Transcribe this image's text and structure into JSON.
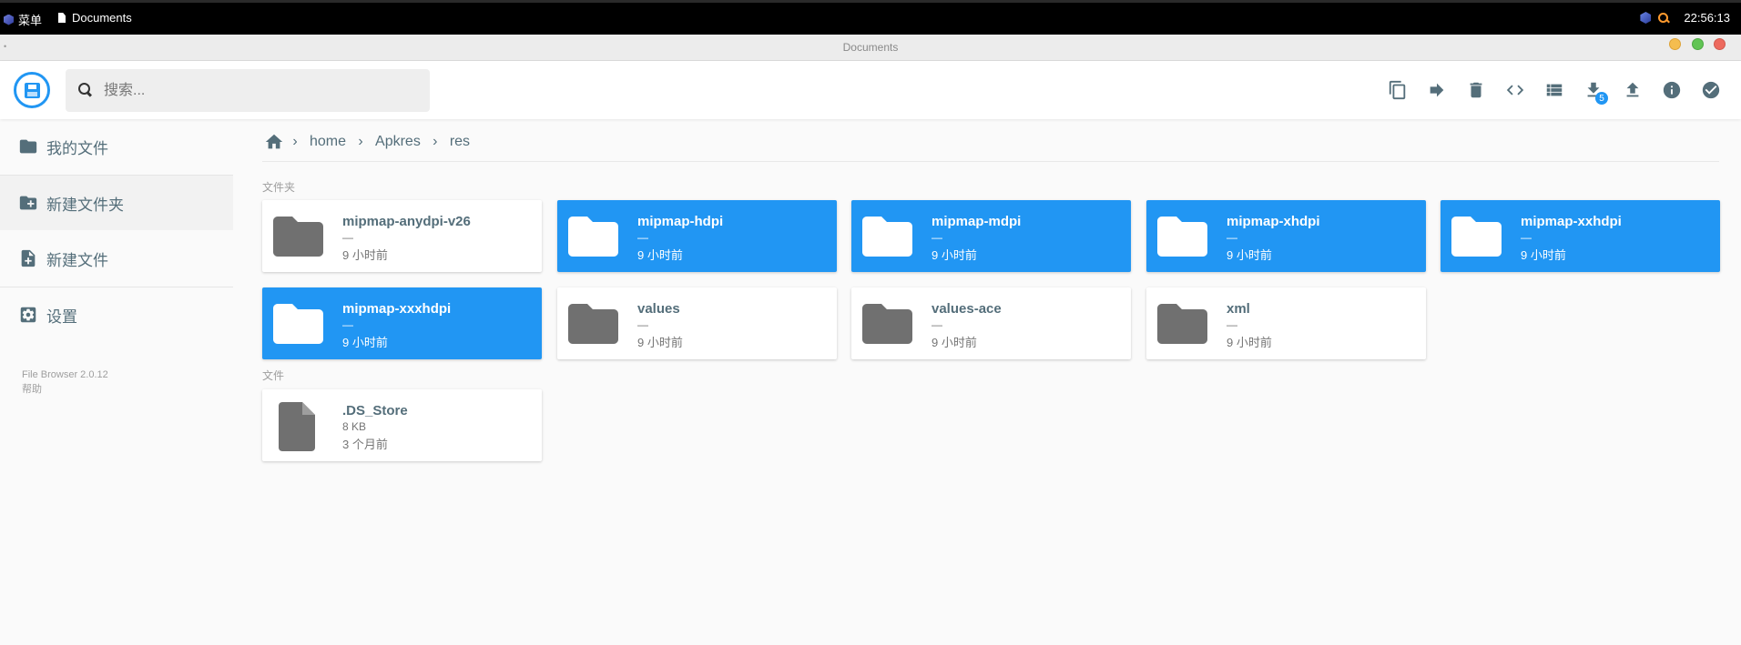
{
  "taskbar": {
    "menu_label": "菜单",
    "task_title": "Documents",
    "clock": "22:56:13"
  },
  "window": {
    "title": "Documents"
  },
  "search": {
    "placeholder": "搜索..."
  },
  "toolbar": {
    "actions": [
      "copy",
      "move",
      "delete",
      "embed",
      "view-mode",
      "download",
      "upload",
      "info",
      "select"
    ],
    "download_badge": "5"
  },
  "sidebar": {
    "items": [
      {
        "label": "我的文件",
        "icon": "folder-icon"
      },
      {
        "label": "新建文件夹",
        "icon": "create-new-folder-icon"
      },
      {
        "label": "新建文件",
        "icon": "note-add-icon"
      },
      {
        "label": "设置",
        "icon": "settings-icon"
      }
    ],
    "footer_version": "File Browser 2.0.12",
    "footer_help": "帮助"
  },
  "breadcrumbs": [
    "home",
    "Apkres",
    "res"
  ],
  "sections": {
    "folders_label": "文件夹",
    "files_label": "文件"
  },
  "folders": [
    {
      "name": "mipmap-anydpi-v26",
      "size": "—",
      "modified": "9 小时前",
      "selected": false
    },
    {
      "name": "mipmap-hdpi",
      "size": "—",
      "modified": "9 小时前",
      "selected": true
    },
    {
      "name": "mipmap-mdpi",
      "size": "—",
      "modified": "9 小时前",
      "selected": true
    },
    {
      "name": "mipmap-xhdpi",
      "size": "—",
      "modified": "9 小时前",
      "selected": true
    },
    {
      "name": "mipmap-xxhdpi",
      "size": "—",
      "modified": "9 小时前",
      "selected": true
    },
    {
      "name": "mipmap-xxxhdpi",
      "size": "—",
      "modified": "9 小时前",
      "selected": true
    },
    {
      "name": "values",
      "size": "—",
      "modified": "9 小时前",
      "selected": false
    },
    {
      "name": "values-ace",
      "size": "—",
      "modified": "9 小时前",
      "selected": false
    },
    {
      "name": "xml",
      "size": "—",
      "modified": "9 小时前",
      "selected": false
    }
  ],
  "files": [
    {
      "name": ".DS_Store",
      "size": "8 KB",
      "modified": "3 个月前",
      "selected": false
    }
  ],
  "colors": {
    "accent": "#2196f3",
    "text": "#546e7a",
    "folder_gray": "#707070"
  }
}
